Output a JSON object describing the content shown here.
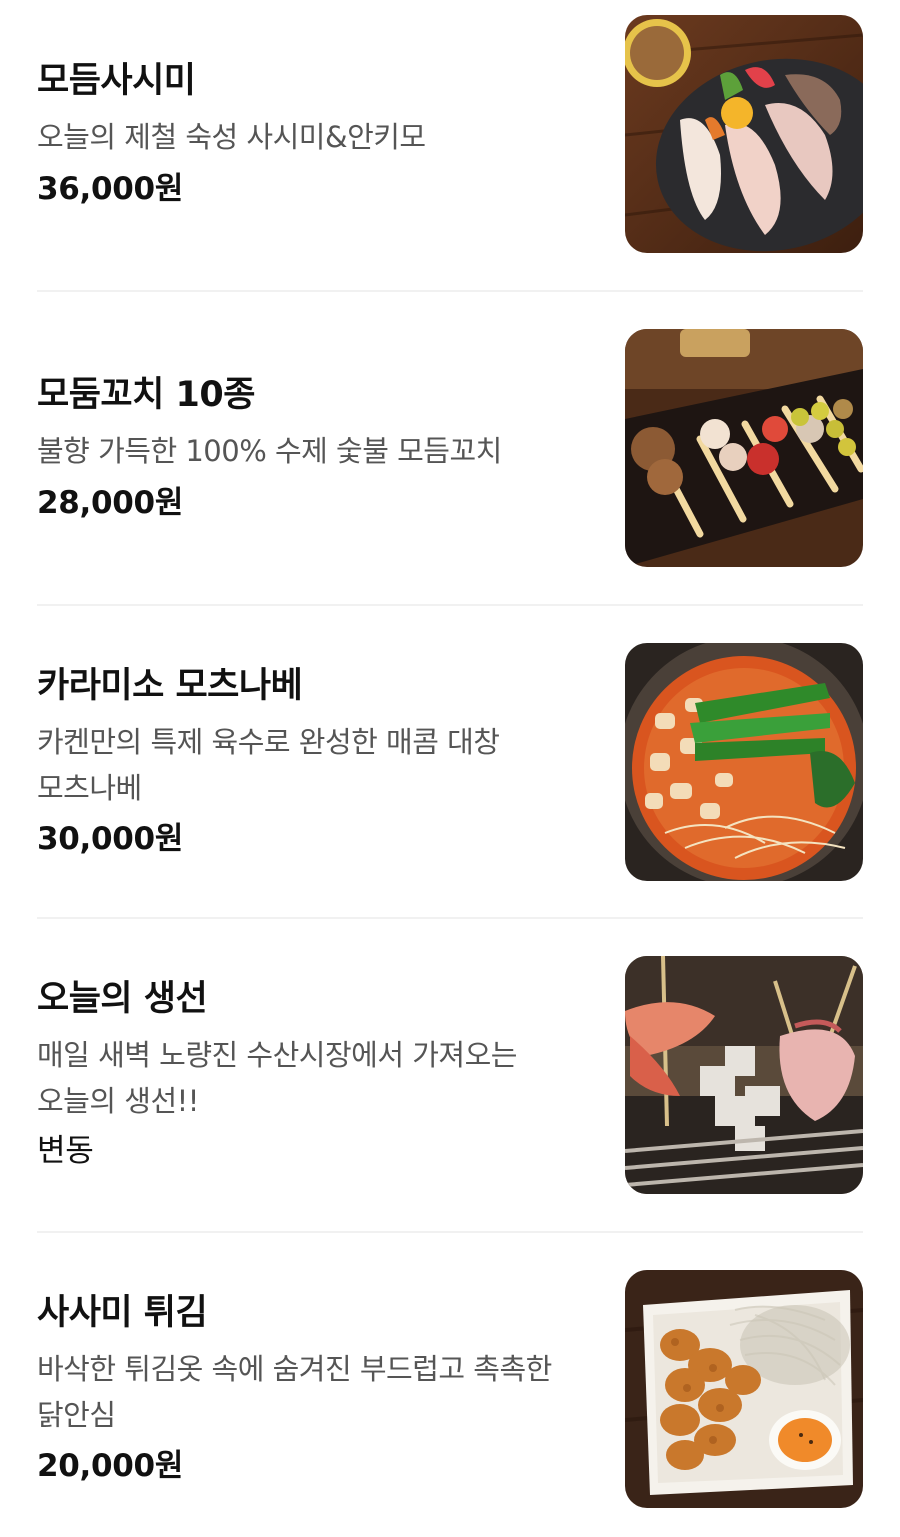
{
  "menu": {
    "items": [
      {
        "name": "모듬사시미",
        "description": "오늘의 제철 숙성 사시미&안키모",
        "price": "36,000원",
        "photo": "sashimi-platter-photo"
      },
      {
        "name": "모둠꼬치 10종",
        "description": "불향 가득한 100% 수제 숯불 모듬꼬치",
        "price": "28,000원",
        "photo": "skewers-photo"
      },
      {
        "name": "카라미소 모츠나베",
        "description": "카켄만의 특제 육수로 완성한 매콤 대창 모츠나베",
        "price": "30,000원",
        "photo": "motsunabe-hotpot-photo"
      },
      {
        "name": "오늘의 생선",
        "description": "매일 새벽 노량진 수산시장에서 가져오는 오늘의 생선!!",
        "price": "변동",
        "photo": "grilled-fish-photo"
      },
      {
        "name": "사사미 튀김",
        "description": "바삭한 튀김옷 속에 숨겨진 부드럽고 촉촉한 닭안심",
        "price": "20,000원",
        "photo": "fried-chicken-tenderloin-photo"
      }
    ]
  },
  "colors": {
    "text": "#111111",
    "description": "#555555",
    "divider": "#f1f1f1",
    "background": "#ffffff"
  }
}
